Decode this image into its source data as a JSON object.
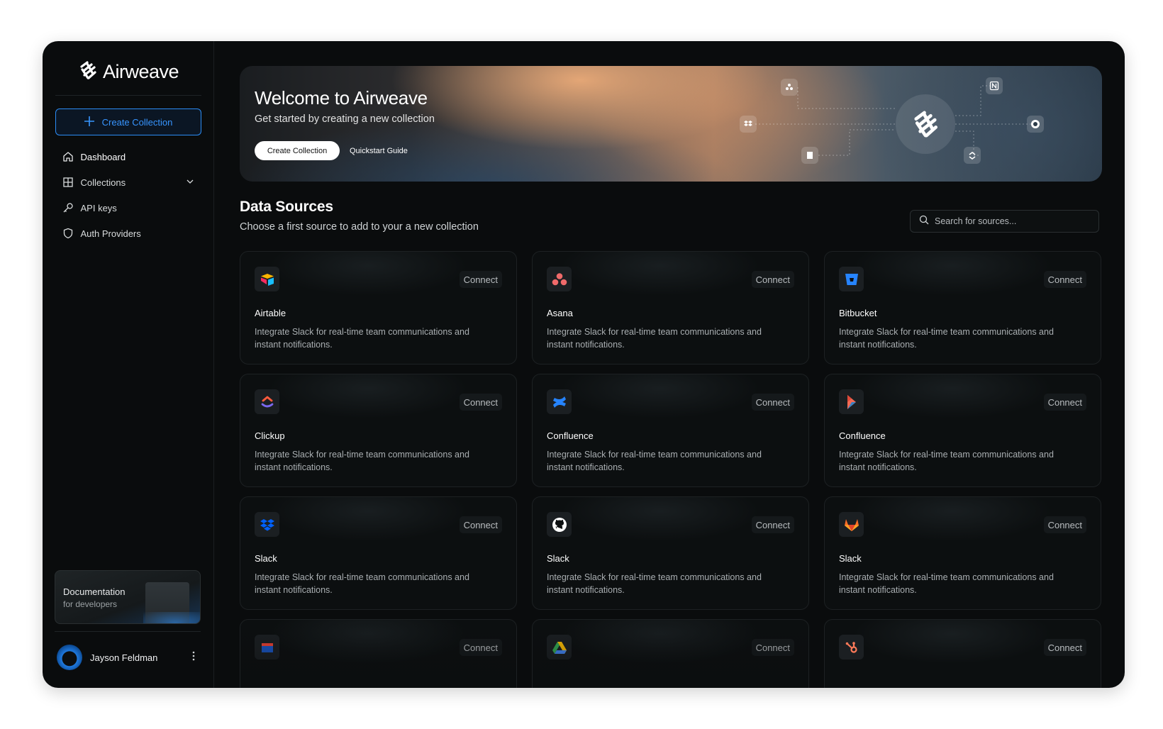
{
  "brand": {
    "name": "Airweave"
  },
  "sidebar": {
    "create_label": "Create Collection",
    "items": [
      {
        "label": "Dashboard",
        "icon": "home-icon"
      },
      {
        "label": "Collections",
        "icon": "grid-icon"
      },
      {
        "label": "API keys",
        "icon": "key-icon"
      },
      {
        "label": "Auth Providers",
        "icon": "shield-icon"
      }
    ],
    "doc": {
      "title": "Documentation",
      "subtitle": "for developers"
    },
    "user": {
      "name": "Jayson Feldman"
    }
  },
  "hero": {
    "title": "Welcome to Airweave",
    "subtitle": "Get started by creating a new collection",
    "primary_label": "Create Collection",
    "secondary_label": "Quickstart Guide"
  },
  "sources": {
    "title": "Data Sources",
    "subtitle": "Choose a first source to add to your a new collection",
    "search_placeholder": "Search for sources...",
    "connect_label": "Connect",
    "cards": [
      {
        "name": "Airtable",
        "desc": "Integrate Slack for real-time team communications and instant notifications.",
        "icon": "airtable-icon"
      },
      {
        "name": "Asana",
        "desc": "Integrate Slack for real-time team communications and instant notifications.",
        "icon": "asana-icon"
      },
      {
        "name": "Bitbucket",
        "desc": "Integrate Slack for real-time team communications and instant notifications.",
        "icon": "bitbucket-icon"
      },
      {
        "name": "Clickup",
        "desc": "Integrate Slack for real-time team communications and instant notifications.",
        "icon": "clickup-icon"
      },
      {
        "name": "Confluence",
        "desc": "Integrate Slack for real-time team communications and instant notifications.",
        "icon": "confluence-icon"
      },
      {
        "name": "Confluence",
        "desc": "Integrate Slack for real-time team communications and instant notifications.",
        "icon": "coda-icon"
      },
      {
        "name": "Slack",
        "desc": "Integrate Slack for real-time team communications and instant notifications.",
        "icon": "dropbox-icon"
      },
      {
        "name": "Slack",
        "desc": "Integrate Slack for real-time team communications and instant notifications.",
        "icon": "github-icon"
      },
      {
        "name": "Slack",
        "desc": "Integrate Slack for real-time team communications and instant notifications.",
        "icon": "gitlab-icon"
      },
      {
        "name": "",
        "desc": "",
        "icon": "calendar-icon"
      },
      {
        "name": "",
        "desc": "",
        "icon": "drive-icon"
      },
      {
        "name": "",
        "desc": "",
        "icon": "hubspot-icon"
      }
    ]
  },
  "colors": {
    "accent": "#2b8cf5",
    "background": "#0a0c0d"
  }
}
